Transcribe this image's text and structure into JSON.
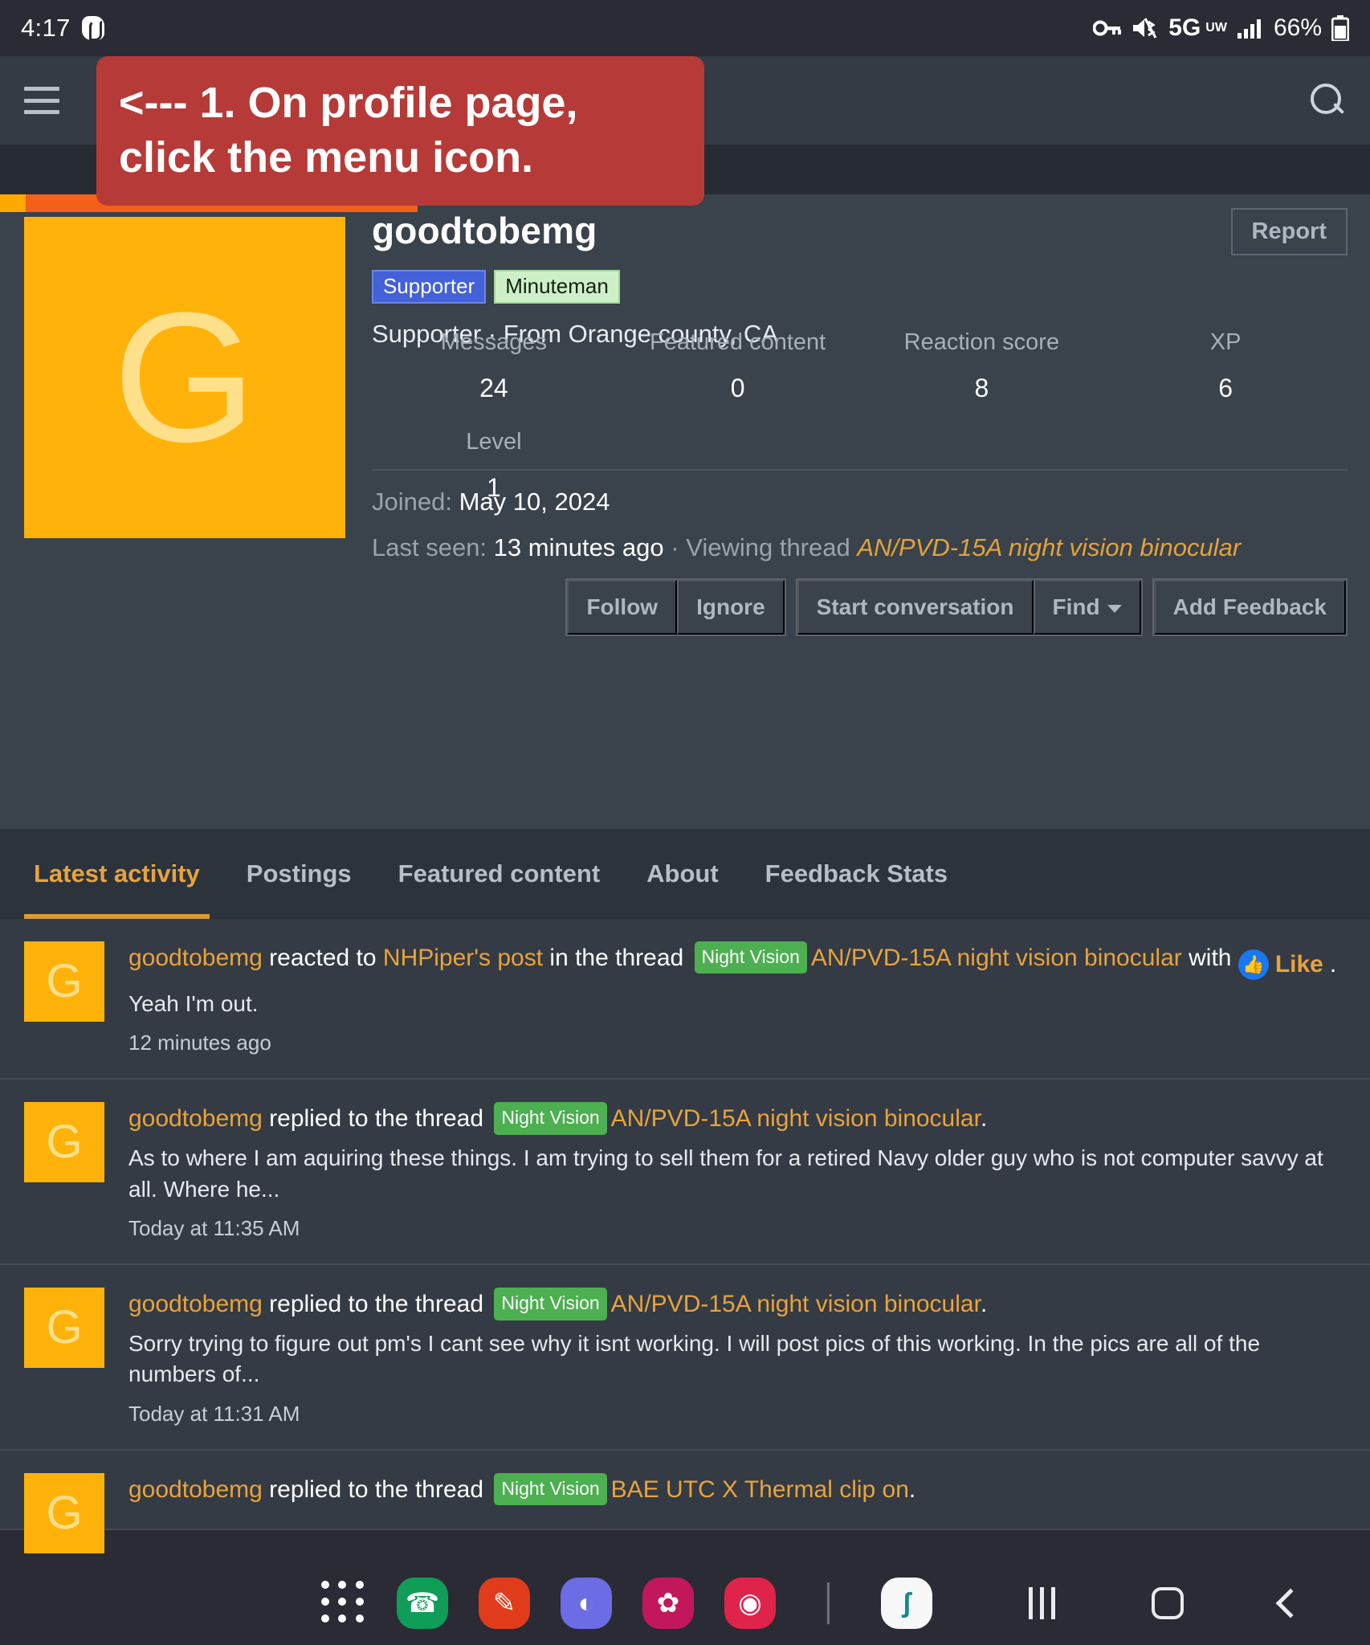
{
  "statusbar": {
    "time": "4:17",
    "vpn_icon": "surfshark-icon",
    "key_icon": "vpn-key-icon",
    "mute_icon": "mute-icon",
    "network": "5G",
    "network_sub": "UW",
    "signal_icon": "signal-bars-icon",
    "battery": "66%",
    "battery_icon": "battery-icon"
  },
  "appbar": {
    "menu_icon": "hamburger-menu-icon",
    "search_icon": "search-icon"
  },
  "annotation": {
    "line1": "<--- 1. On profile page,",
    "line2": "click the menu icon.",
    "color": "#b63a37"
  },
  "profile": {
    "avatar_letter": "G",
    "username": "goodtobemg",
    "badges": [
      {
        "label": "Supporter",
        "style": "supporter"
      },
      {
        "label": "Minuteman",
        "style": "minuteman"
      }
    ],
    "title_line": "Supporter · From Orange county, CA",
    "report_label": "Report",
    "stats": [
      {
        "label": "Messages",
        "value": "24"
      },
      {
        "label": "Featured content",
        "value": "0"
      },
      {
        "label": "Reaction score",
        "value": "8"
      },
      {
        "label": "XP",
        "value": "6"
      },
      {
        "label": "Level",
        "value": "1"
      }
    ],
    "joined_label": "Joined:",
    "joined_value": "May 10, 2024",
    "lastseen_label": "Last seen:",
    "lastseen_value": "13 minutes ago",
    "lastseen_mid": "· Viewing thread",
    "lastseen_thread": "AN/PVD-15A night vision binocular",
    "actions": {
      "follow": "Follow",
      "ignore": "Ignore",
      "start_conversation": "Start conversation",
      "find": "Find",
      "add_feedback": "Add Feedback"
    }
  },
  "tabs": [
    {
      "label": "Latest activity",
      "active": true
    },
    {
      "label": "Postings",
      "active": false
    },
    {
      "label": "Featured content",
      "active": false
    },
    {
      "label": "About",
      "active": false
    },
    {
      "label": "Feedback Stats",
      "active": false
    }
  ],
  "feed": [
    {
      "avatar": "G",
      "user": "goodtobemg",
      "action": "reacted to",
      "target_user": "NHPiper's post",
      "mid": "in the thread",
      "prefix": "Night Vision",
      "thread": "AN/PVD-15A night vision binocular",
      "tail": "with",
      "reaction": "Like",
      "reaction_icon": "thumbs-up-icon",
      "snippet": "Yeah I'm out.",
      "when": "12 minutes ago"
    },
    {
      "avatar": "G",
      "user": "goodtobemg",
      "action": "replied to the thread",
      "prefix": "Night Vision",
      "thread": "AN/PVD-15A night vision binocular",
      "snippet": "As to where I am aquiring these things. I am trying to sell them for a retired Navy older guy who is not computer savvy at all. Where he...",
      "when": "Today at 11:35 AM"
    },
    {
      "avatar": "G",
      "user": "goodtobemg",
      "action": "replied to the thread",
      "prefix": "Night Vision",
      "thread": "AN/PVD-15A night vision binocular",
      "snippet": "Sorry trying to figure out pm's I cant see why it isnt working. I will post pics of this working. In the pics are all of the numbers of...",
      "when": "Today at 11:31 AM"
    },
    {
      "avatar": "G",
      "user": "goodtobemg",
      "action": "replied to the thread",
      "prefix": "Night Vision",
      "thread": "BAE UTC X Thermal clip on",
      "snippet": "",
      "when": ""
    }
  ],
  "dock": {
    "apps": [
      {
        "name": "app-drawer-icon",
        "glyph": "",
        "color": "#2b2b35"
      },
      {
        "name": "phone-icon",
        "glyph": "✆",
        "color": "#0f9d58"
      },
      {
        "name": "messages-icon",
        "glyph": "✉",
        "color": "#e03c1b"
      },
      {
        "name": "internet-browser-icon",
        "glyph": "◐",
        "color": "#6c6ce5"
      },
      {
        "name": "gallery-icon",
        "glyph": "✿",
        "color": "#c2185b"
      },
      {
        "name": "camera-icon",
        "glyph": "◉",
        "color": "#e0234b"
      },
      {
        "name": "surfshark-vpn-icon",
        "glyph": "ʃ",
        "color": "#f7f7f7"
      }
    ],
    "nav": [
      {
        "name": "recents-button",
        "glyph": "|||"
      },
      {
        "name": "home-button",
        "glyph": "▢"
      },
      {
        "name": "back-button",
        "glyph": "‹"
      }
    ]
  }
}
